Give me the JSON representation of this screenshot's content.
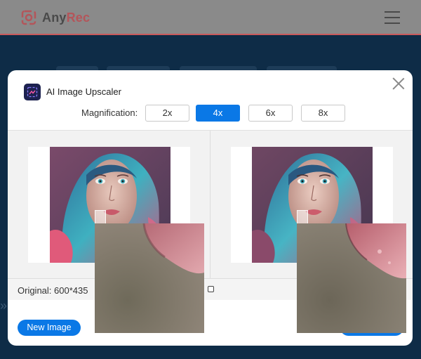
{
  "site": {
    "logo_text_main": "Any",
    "logo_text_accent": "Rec",
    "logo_icon": "anyrec-logo-icon",
    "menu_icon": "hamburger-menu-icon"
  },
  "modal": {
    "title": "AI Image Upscaler",
    "title_icon": "ai-upscaler-icon",
    "close_icon": "close-icon",
    "magnification": {
      "label": "Magnification:",
      "options": [
        "2x",
        "4x",
        "6x",
        "8x"
      ],
      "selected": "4x"
    },
    "original_info": "Original: 600*435",
    "new_image_button": "New Image",
    "save_button": ""
  },
  "colors": {
    "accent_blue": "#0a78e6",
    "brand_red": "#d6484e",
    "page_bg": "#0e2c47"
  }
}
